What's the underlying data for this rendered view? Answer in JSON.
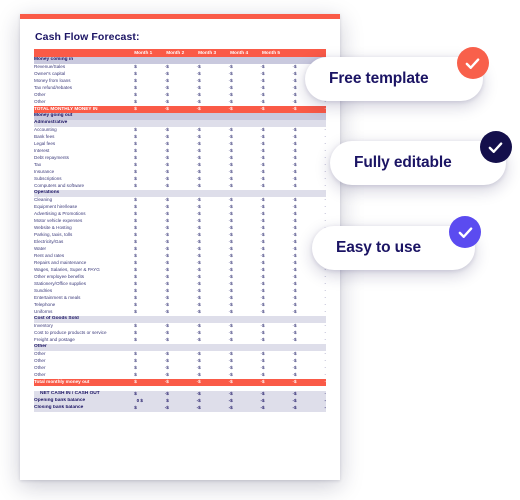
{
  "document": {
    "title": "Cash Flow Forecast:",
    "accent_color": "#fa5a47",
    "text_color": "#1b1464"
  },
  "table": {
    "label_header": "",
    "month_headers": [
      "Month 1",
      "Month 2",
      "Month 3",
      "Month 4",
      "Month 5"
    ],
    "currency_symbol": "$",
    "empty_value": "-",
    "zero_value": "0",
    "sections": [
      {
        "kind": "band",
        "title": "Money coming in",
        "rows": [
          "Revenue/Sales",
          "Owner's capital",
          "Money from loans",
          "Tax refund/rebates",
          "Other",
          "Other"
        ]
      },
      {
        "kind": "total",
        "title": "TOTAL MONTHLY MONEY IN",
        "rows": []
      },
      {
        "kind": "band",
        "title": "Money going out",
        "rows": []
      },
      {
        "kind": "band2",
        "title": "Administrative",
        "rows": [
          "Accounting",
          "Bank fees",
          "Legal fees",
          "Interest",
          "Debt repayments",
          "Tax",
          "Insurance",
          "Subscriptions",
          "Computers and software"
        ]
      },
      {
        "kind": "band2",
        "title": "Operations",
        "rows": [
          "Cleaning",
          "Equipment hire/lease",
          "Advertising & Promotions",
          "Motor vehicle expenses",
          "Website & Hosting",
          "Parking, taxis, tolls",
          "Electricity/Gas",
          "Water",
          "Rent and rates",
          "Repairs and maintenance",
          "Wages, Salaries, Super & PAYG",
          "Other employee benefits",
          "Stationery/Office supplies",
          "Sundries",
          "Entertainment & meals",
          "Telephone",
          "Uniforms"
        ]
      },
      {
        "kind": "band2",
        "title": "Cost of Goods Sold",
        "rows": [
          "Inventory",
          "Cost to produce products or service",
          "Freight and postage"
        ]
      },
      {
        "kind": "band2",
        "title": "Other",
        "rows": [
          "Other",
          "Other",
          "Other",
          "Other"
        ]
      },
      {
        "kind": "total",
        "title": "Total monthly money out",
        "rows": []
      },
      {
        "kind": "net",
        "title": "NET CASH IN / CASH OUT",
        "rows": []
      },
      {
        "kind": "balance",
        "title": "Opening bank balance",
        "first_value": "0",
        "rows": []
      },
      {
        "kind": "balance",
        "title": "Closing bank balance",
        "rows": []
      }
    ]
  },
  "badges": [
    {
      "label": "Free template",
      "check_color": "#f8604b",
      "icon": "check-icon"
    },
    {
      "label": "Fully editable",
      "check_color": "#140f4b",
      "icon": "check-icon"
    },
    {
      "label": "Easy to use",
      "check_color": "#5b4bf0",
      "icon": "check-icon"
    }
  ]
}
